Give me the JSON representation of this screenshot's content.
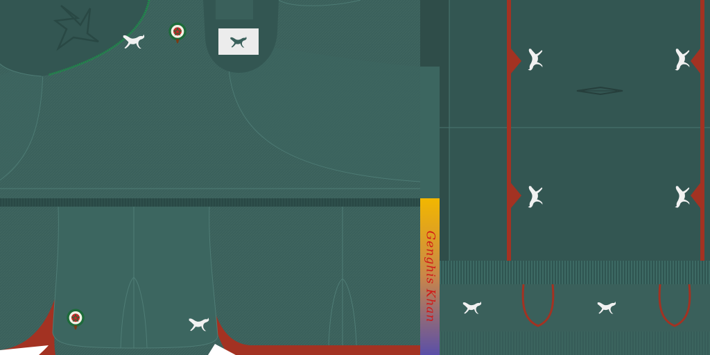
{
  "texture": {
    "signature_text": "Genghis Khan",
    "brand_logo": "puma-logo",
    "crest": "morocco-federation-crest",
    "shirt_emblem": "star-outline-emblem",
    "sleeve_emblem": "sleeve-diamond-emblem",
    "colors": {
      "kit_green": "#3a605b",
      "kit_green_dark": "#335652",
      "kit_green_panel": "#3c6660",
      "collar_trim": "#1f8a4a",
      "accent_red": "#a33222",
      "logo_white": "#f1f1f1",
      "label_bg": "#ececec",
      "gradient_top": "#f2b700",
      "gradient_bottom": "#5a4fa8",
      "signature_red": "#d01717"
    }
  }
}
